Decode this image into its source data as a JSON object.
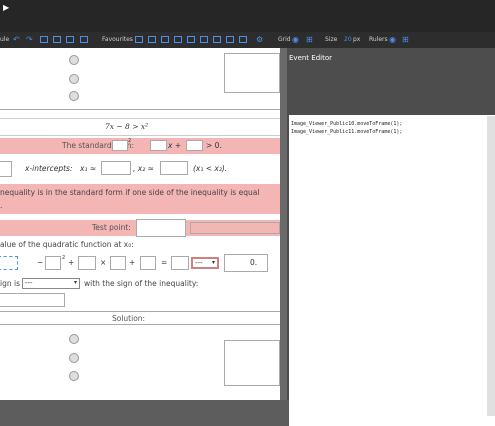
{
  "toolbar": {
    "left_label": "ule",
    "favourites_label": "Favourites",
    "grid_label": "Grid",
    "size_label": "Size",
    "size_value": "20",
    "size_unit": "px",
    "rulers_label": "Rulers"
  },
  "event_editor": {
    "title": "Event Editor",
    "lines": [
      "Image_Viewer_Public10.moveToFrame(1);",
      "Image_Viewer_Public11.moveToFrame(1);"
    ]
  },
  "canvas": {
    "inequality": "7x − 8 > x²",
    "standard_form": {
      "prefix": "The standard form:",
      "sup": "2",
      "x_part": "x +",
      "tail": "> 0."
    },
    "x_intercepts": {
      "label": "x-intercepts:",
      "x1": "x₁ ≈",
      "x2": ", x₂ ≈",
      "cond": "(x₁ < x₂)."
    },
    "info_line1": "nequality is in the standard form if one side of the inequality is equal",
    "info_line2": ".",
    "test_point": "Test point:",
    "value_text": "alue of the quadratic function at x₀:",
    "expr": {
      "minus": "−",
      "sup": "2",
      "plus": "+",
      "times": "×",
      "plus2": "+",
      "eq": "=",
      "zero": "0."
    },
    "sign_text": "ign is",
    "sign_select": "---",
    "sign_tail": "with the sign of the inequality:",
    "compare_select": "---",
    "solution": "Solution:"
  }
}
